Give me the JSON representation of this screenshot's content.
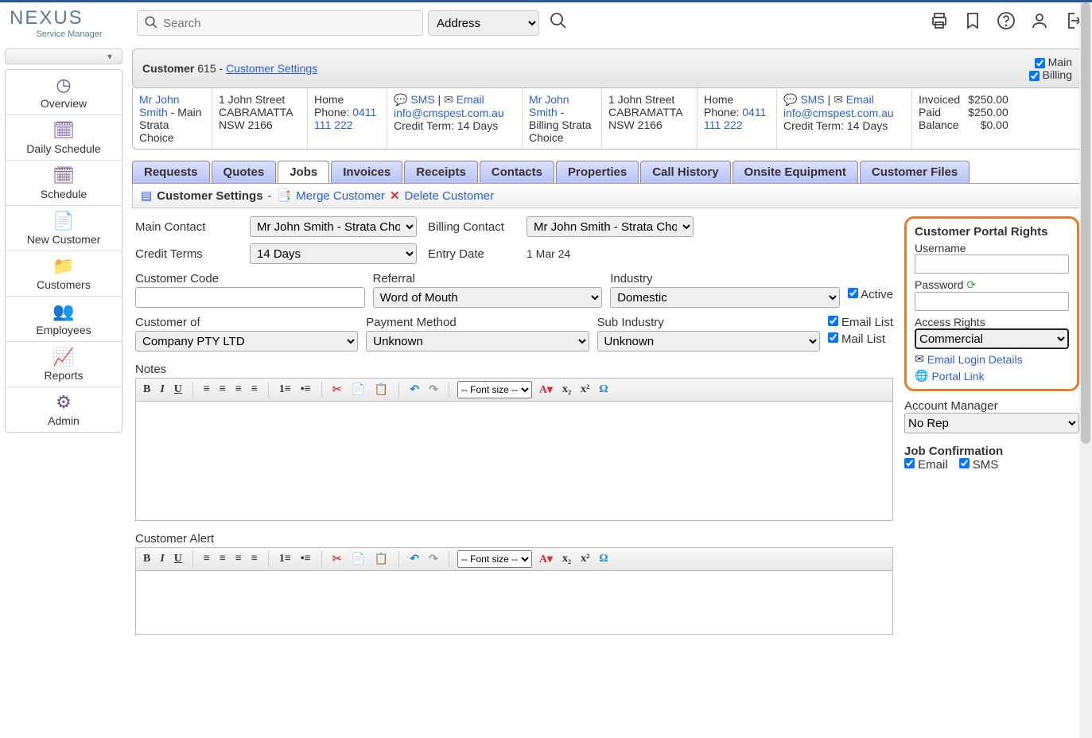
{
  "logo": {
    "main": "NEXUS",
    "sub": "Service Manager"
  },
  "search": {
    "placeholder": "Search",
    "dropdown": "Address"
  },
  "sidebar": [
    {
      "label": "Overview"
    },
    {
      "label": "Daily Schedule"
    },
    {
      "label": "Schedule"
    },
    {
      "label": "New Customer"
    },
    {
      "label": "Customers"
    },
    {
      "label": "Employees"
    },
    {
      "label": "Reports"
    },
    {
      "label": "Admin"
    }
  ],
  "customer": {
    "title_prefix": "Customer",
    "number": "615",
    "settings_link": "Customer Settings",
    "main_checkbox": "Main",
    "billing_checkbox": "Billing"
  },
  "info": {
    "contact_name": "Mr John Smith",
    "main_suffix": " - Main Strata Choice",
    "billing_suffix": " - Billing Strata Choice",
    "address": "1 John Street CABRAMATTA NSW 2166",
    "phone_label": "Home Phone: ",
    "phone": "0411 111 222",
    "sms": "SMS",
    "email_label": "Email",
    "email": "info@cmspest.com.au",
    "credit_term": "Credit Term: 14 Days",
    "invoiced_label": "Invoiced",
    "invoiced": "$250.00",
    "paid_label": "Paid",
    "paid": "$250.00",
    "balance_label": "Balance",
    "balance": "$0.00"
  },
  "tabs": [
    "Requests",
    "Quotes",
    "Jobs",
    "Invoices",
    "Receipts",
    "Contacts",
    "Properties",
    "Call History",
    "Onsite Equipment",
    "Customer Files"
  ],
  "active_tab": "Jobs",
  "sub": {
    "title": "Customer Settings",
    "merge": "Merge Customer",
    "delete": "Delete Customer"
  },
  "form": {
    "main_contact_label": "Main Contact",
    "main_contact": "Mr John Smith - Strata Cho",
    "billing_contact_label": "Billing Contact",
    "billing_contact": "Mr John Smith - Strata Cho",
    "credit_terms_label": "Credit Terms",
    "credit_terms": "14 Days",
    "entry_date_label": "Entry Date",
    "entry_date": "1 Mar 24",
    "customer_code_label": "Customer Code",
    "customer_code": "",
    "referral_label": "Referral",
    "referral": "Word of Mouth",
    "industry_label": "Industry",
    "industry": "Domestic",
    "customer_of_label": "Customer of",
    "customer_of": "Company PTY LTD",
    "payment_method_label": "Payment Method",
    "payment_method": "Unknown",
    "sub_industry_label": "Sub Industry",
    "sub_industry": "Unknown",
    "active": "Active",
    "email_list": "Email List",
    "mail_list": "Mail List",
    "notes_label": "Notes",
    "alert_label": "Customer Alert",
    "fontsize": "-- Font size --"
  },
  "portal": {
    "heading": "Customer Portal Rights",
    "username_label": "Username",
    "password_label": "Password",
    "access_label": "Access Rights",
    "access_value": "Commercial",
    "email_login": "Email Login Details",
    "portal_link": "Portal Link"
  },
  "acct": {
    "label": "Account Manager",
    "value": "No Rep"
  },
  "jobconf": {
    "heading": "Job Confirmation",
    "email": "Email",
    "sms": "SMS"
  }
}
